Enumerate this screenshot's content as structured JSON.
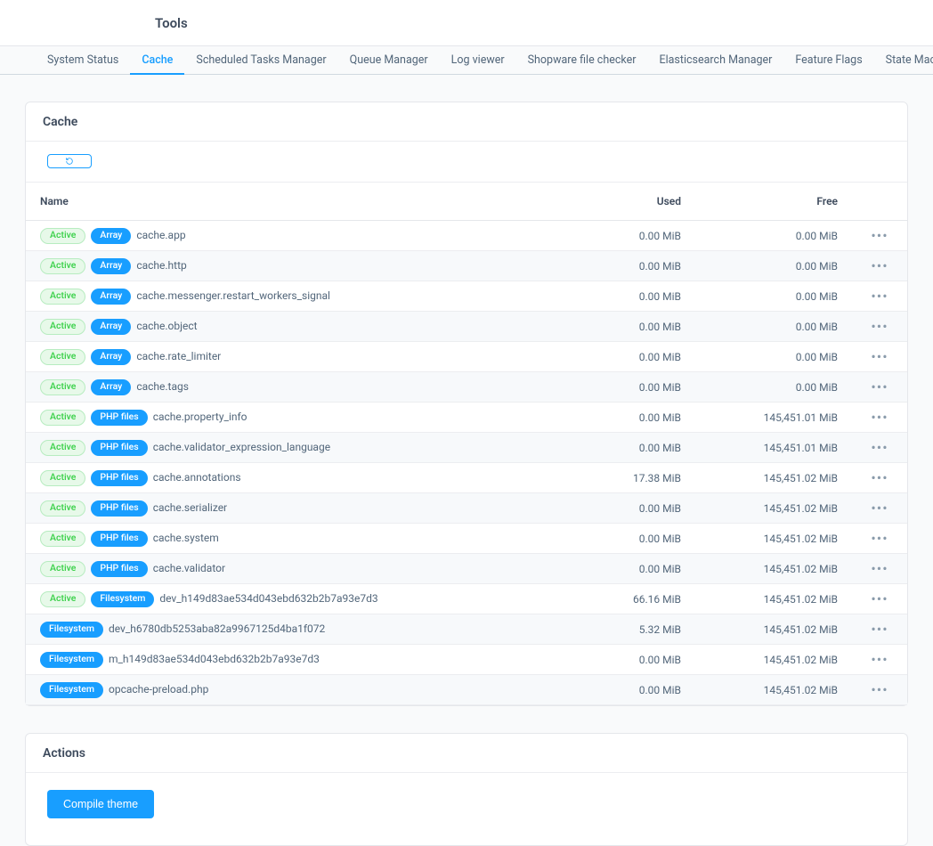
{
  "header": {
    "title": "Tools"
  },
  "tabs": [
    {
      "label": "System Status",
      "active": false
    },
    {
      "label": "Cache",
      "active": true
    },
    {
      "label": "Scheduled Tasks Manager",
      "active": false
    },
    {
      "label": "Queue Manager",
      "active": false
    },
    {
      "label": "Log viewer",
      "active": false
    },
    {
      "label": "Shopware file checker",
      "active": false
    },
    {
      "label": "Elasticsearch Manager",
      "active": false
    },
    {
      "label": "Feature Flags",
      "active": false
    },
    {
      "label": "State Machine Viewer",
      "active": false
    }
  ],
  "card": {
    "title": "Cache"
  },
  "columns": {
    "name": "Name",
    "used": "Used",
    "free": "Free"
  },
  "badge_labels": {
    "active": "Active"
  },
  "rows": [
    {
      "active": true,
      "type": "Array",
      "name": "cache.app",
      "used": "0.00 MiB",
      "free": "0.00 MiB"
    },
    {
      "active": true,
      "type": "Array",
      "name": "cache.http",
      "used": "0.00 MiB",
      "free": "0.00 MiB"
    },
    {
      "active": true,
      "type": "Array",
      "name": "cache.messenger.restart_workers_signal",
      "used": "0.00 MiB",
      "free": "0.00 MiB"
    },
    {
      "active": true,
      "type": "Array",
      "name": "cache.object",
      "used": "0.00 MiB",
      "free": "0.00 MiB"
    },
    {
      "active": true,
      "type": "Array",
      "name": "cache.rate_limiter",
      "used": "0.00 MiB",
      "free": "0.00 MiB"
    },
    {
      "active": true,
      "type": "Array",
      "name": "cache.tags",
      "used": "0.00 MiB",
      "free": "0.00 MiB"
    },
    {
      "active": true,
      "type": "PHP files",
      "name": "cache.property_info",
      "used": "0.00 MiB",
      "free": "145,451.01 MiB"
    },
    {
      "active": true,
      "type": "PHP files",
      "name": "cache.validator_expression_language",
      "used": "0.00 MiB",
      "free": "145,451.01 MiB"
    },
    {
      "active": true,
      "type": "PHP files",
      "name": "cache.annotations",
      "used": "17.38 MiB",
      "free": "145,451.02 MiB"
    },
    {
      "active": true,
      "type": "PHP files",
      "name": "cache.serializer",
      "used": "0.00 MiB",
      "free": "145,451.02 MiB"
    },
    {
      "active": true,
      "type": "PHP files",
      "name": "cache.system",
      "used": "0.00 MiB",
      "free": "145,451.02 MiB"
    },
    {
      "active": true,
      "type": "PHP files",
      "name": "cache.validator",
      "used": "0.00 MiB",
      "free": "145,451.02 MiB"
    },
    {
      "active": true,
      "type": "Filesystem",
      "name": "dev_h149d83ae534d043ebd632b2b7a93e7d3",
      "used": "66.16 MiB",
      "free": "145,451.02 MiB"
    },
    {
      "active": false,
      "type": "Filesystem",
      "name": "dev_h6780db5253aba82a9967125d4ba1f072",
      "used": "5.32 MiB",
      "free": "145,451.02 MiB"
    },
    {
      "active": false,
      "type": "Filesystem",
      "name": "m_h149d83ae534d043ebd632b2b7a93e7d3",
      "used": "0.00 MiB",
      "free": "145,451.02 MiB"
    },
    {
      "active": false,
      "type": "Filesystem",
      "name": "opcache-preload.php",
      "used": "0.00 MiB",
      "free": "145,451.02 MiB"
    }
  ],
  "actions_card": {
    "title": "Actions"
  },
  "buttons": {
    "compile_theme": "Compile theme"
  }
}
